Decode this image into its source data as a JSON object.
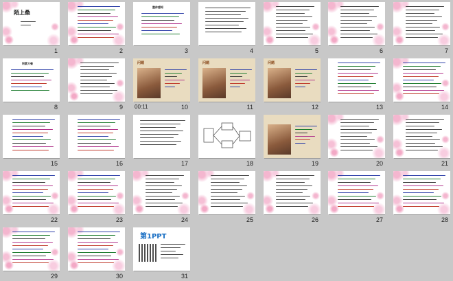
{
  "slides": [
    {
      "n": "1",
      "title": "陌上桑",
      "bg": "pink",
      "kind": "title"
    },
    {
      "n": "2",
      "bg": "pink",
      "kind": "text-colored"
    },
    {
      "n": "3",
      "bg": "white",
      "kind": "text-header",
      "header": "整体感知"
    },
    {
      "n": "4",
      "bg": "white",
      "kind": "text-plain"
    },
    {
      "n": "5",
      "bg": "pink",
      "kind": "text-list"
    },
    {
      "n": "6",
      "bg": "pink",
      "kind": "text-list"
    },
    {
      "n": "7",
      "bg": "pink",
      "kind": "text-list"
    },
    {
      "n": "8",
      "bg": "white",
      "kind": "text-header",
      "header": "积累大餐"
    },
    {
      "n": "9",
      "bg": "pink",
      "kind": "text-list"
    },
    {
      "n": "10",
      "bg": "paper",
      "kind": "photo",
      "timer": "00:11",
      "header": "问题"
    },
    {
      "n": "11",
      "bg": "paper",
      "kind": "photo",
      "header": "问题"
    },
    {
      "n": "12",
      "bg": "paper",
      "kind": "photo",
      "header": "问题"
    },
    {
      "n": "13",
      "bg": "white",
      "kind": "text-colored"
    },
    {
      "n": "14",
      "bg": "pink",
      "kind": "text-colored"
    },
    {
      "n": "15",
      "bg": "white",
      "kind": "text-colored"
    },
    {
      "n": "16",
      "bg": "white",
      "kind": "text-colored"
    },
    {
      "n": "17",
      "bg": "white",
      "kind": "text-plain"
    },
    {
      "n": "18",
      "bg": "white",
      "kind": "diagram"
    },
    {
      "n": "19",
      "bg": "paper",
      "kind": "photo"
    },
    {
      "n": "20",
      "bg": "pink",
      "kind": "text-list"
    },
    {
      "n": "21",
      "bg": "pink",
      "kind": "text-list"
    },
    {
      "n": "22",
      "bg": "pink",
      "kind": "text-colored"
    },
    {
      "n": "23",
      "bg": "pink",
      "kind": "text-colored"
    },
    {
      "n": "24",
      "bg": "pink",
      "kind": "text-list"
    },
    {
      "n": "25",
      "bg": "pink",
      "kind": "text-list"
    },
    {
      "n": "26",
      "bg": "pink",
      "kind": "text-list"
    },
    {
      "n": "27",
      "bg": "pink",
      "kind": "text-colored"
    },
    {
      "n": "28",
      "bg": "pink",
      "kind": "text-colored"
    },
    {
      "n": "29",
      "bg": "pink",
      "kind": "text-colored"
    },
    {
      "n": "30",
      "bg": "pink",
      "kind": "text-colored"
    },
    {
      "n": "31",
      "bg": "white",
      "kind": "logo",
      "logo": "第1PPT"
    }
  ]
}
